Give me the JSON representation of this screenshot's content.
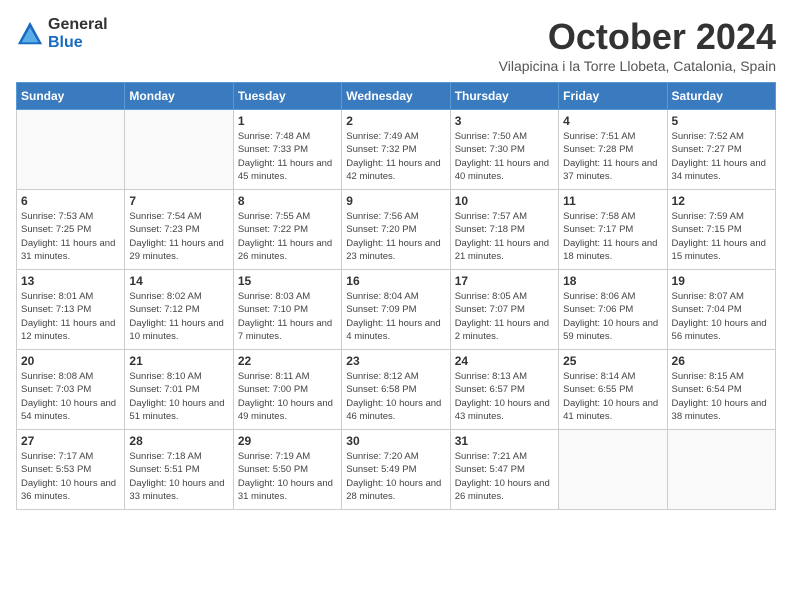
{
  "header": {
    "logo_general": "General",
    "logo_blue": "Blue",
    "month_title": "October 2024",
    "location": "Vilapicina i la Torre Llobeta, Catalonia, Spain"
  },
  "days_of_week": [
    "Sunday",
    "Monday",
    "Tuesday",
    "Wednesday",
    "Thursday",
    "Friday",
    "Saturday"
  ],
  "weeks": [
    [
      {
        "day": "",
        "detail": ""
      },
      {
        "day": "",
        "detail": ""
      },
      {
        "day": "1",
        "detail": "Sunrise: 7:48 AM\nSunset: 7:33 PM\nDaylight: 11 hours and 45 minutes."
      },
      {
        "day": "2",
        "detail": "Sunrise: 7:49 AM\nSunset: 7:32 PM\nDaylight: 11 hours and 42 minutes."
      },
      {
        "day": "3",
        "detail": "Sunrise: 7:50 AM\nSunset: 7:30 PM\nDaylight: 11 hours and 40 minutes."
      },
      {
        "day": "4",
        "detail": "Sunrise: 7:51 AM\nSunset: 7:28 PM\nDaylight: 11 hours and 37 minutes."
      },
      {
        "day": "5",
        "detail": "Sunrise: 7:52 AM\nSunset: 7:27 PM\nDaylight: 11 hours and 34 minutes."
      }
    ],
    [
      {
        "day": "6",
        "detail": "Sunrise: 7:53 AM\nSunset: 7:25 PM\nDaylight: 11 hours and 31 minutes."
      },
      {
        "day": "7",
        "detail": "Sunrise: 7:54 AM\nSunset: 7:23 PM\nDaylight: 11 hours and 29 minutes."
      },
      {
        "day": "8",
        "detail": "Sunrise: 7:55 AM\nSunset: 7:22 PM\nDaylight: 11 hours and 26 minutes."
      },
      {
        "day": "9",
        "detail": "Sunrise: 7:56 AM\nSunset: 7:20 PM\nDaylight: 11 hours and 23 minutes."
      },
      {
        "day": "10",
        "detail": "Sunrise: 7:57 AM\nSunset: 7:18 PM\nDaylight: 11 hours and 21 minutes."
      },
      {
        "day": "11",
        "detail": "Sunrise: 7:58 AM\nSunset: 7:17 PM\nDaylight: 11 hours and 18 minutes."
      },
      {
        "day": "12",
        "detail": "Sunrise: 7:59 AM\nSunset: 7:15 PM\nDaylight: 11 hours and 15 minutes."
      }
    ],
    [
      {
        "day": "13",
        "detail": "Sunrise: 8:01 AM\nSunset: 7:13 PM\nDaylight: 11 hours and 12 minutes."
      },
      {
        "day": "14",
        "detail": "Sunrise: 8:02 AM\nSunset: 7:12 PM\nDaylight: 11 hours and 10 minutes."
      },
      {
        "day": "15",
        "detail": "Sunrise: 8:03 AM\nSunset: 7:10 PM\nDaylight: 11 hours and 7 minutes."
      },
      {
        "day": "16",
        "detail": "Sunrise: 8:04 AM\nSunset: 7:09 PM\nDaylight: 11 hours and 4 minutes."
      },
      {
        "day": "17",
        "detail": "Sunrise: 8:05 AM\nSunset: 7:07 PM\nDaylight: 11 hours and 2 minutes."
      },
      {
        "day": "18",
        "detail": "Sunrise: 8:06 AM\nSunset: 7:06 PM\nDaylight: 10 hours and 59 minutes."
      },
      {
        "day": "19",
        "detail": "Sunrise: 8:07 AM\nSunset: 7:04 PM\nDaylight: 10 hours and 56 minutes."
      }
    ],
    [
      {
        "day": "20",
        "detail": "Sunrise: 8:08 AM\nSunset: 7:03 PM\nDaylight: 10 hours and 54 minutes."
      },
      {
        "day": "21",
        "detail": "Sunrise: 8:10 AM\nSunset: 7:01 PM\nDaylight: 10 hours and 51 minutes."
      },
      {
        "day": "22",
        "detail": "Sunrise: 8:11 AM\nSunset: 7:00 PM\nDaylight: 10 hours and 49 minutes."
      },
      {
        "day": "23",
        "detail": "Sunrise: 8:12 AM\nSunset: 6:58 PM\nDaylight: 10 hours and 46 minutes."
      },
      {
        "day": "24",
        "detail": "Sunrise: 8:13 AM\nSunset: 6:57 PM\nDaylight: 10 hours and 43 minutes."
      },
      {
        "day": "25",
        "detail": "Sunrise: 8:14 AM\nSunset: 6:55 PM\nDaylight: 10 hours and 41 minutes."
      },
      {
        "day": "26",
        "detail": "Sunrise: 8:15 AM\nSunset: 6:54 PM\nDaylight: 10 hours and 38 minutes."
      }
    ],
    [
      {
        "day": "27",
        "detail": "Sunrise: 7:17 AM\nSunset: 5:53 PM\nDaylight: 10 hours and 36 minutes."
      },
      {
        "day": "28",
        "detail": "Sunrise: 7:18 AM\nSunset: 5:51 PM\nDaylight: 10 hours and 33 minutes."
      },
      {
        "day": "29",
        "detail": "Sunrise: 7:19 AM\nSunset: 5:50 PM\nDaylight: 10 hours and 31 minutes."
      },
      {
        "day": "30",
        "detail": "Sunrise: 7:20 AM\nSunset: 5:49 PM\nDaylight: 10 hours and 28 minutes."
      },
      {
        "day": "31",
        "detail": "Sunrise: 7:21 AM\nSunset: 5:47 PM\nDaylight: 10 hours and 26 minutes."
      },
      {
        "day": "",
        "detail": ""
      },
      {
        "day": "",
        "detail": ""
      }
    ]
  ]
}
